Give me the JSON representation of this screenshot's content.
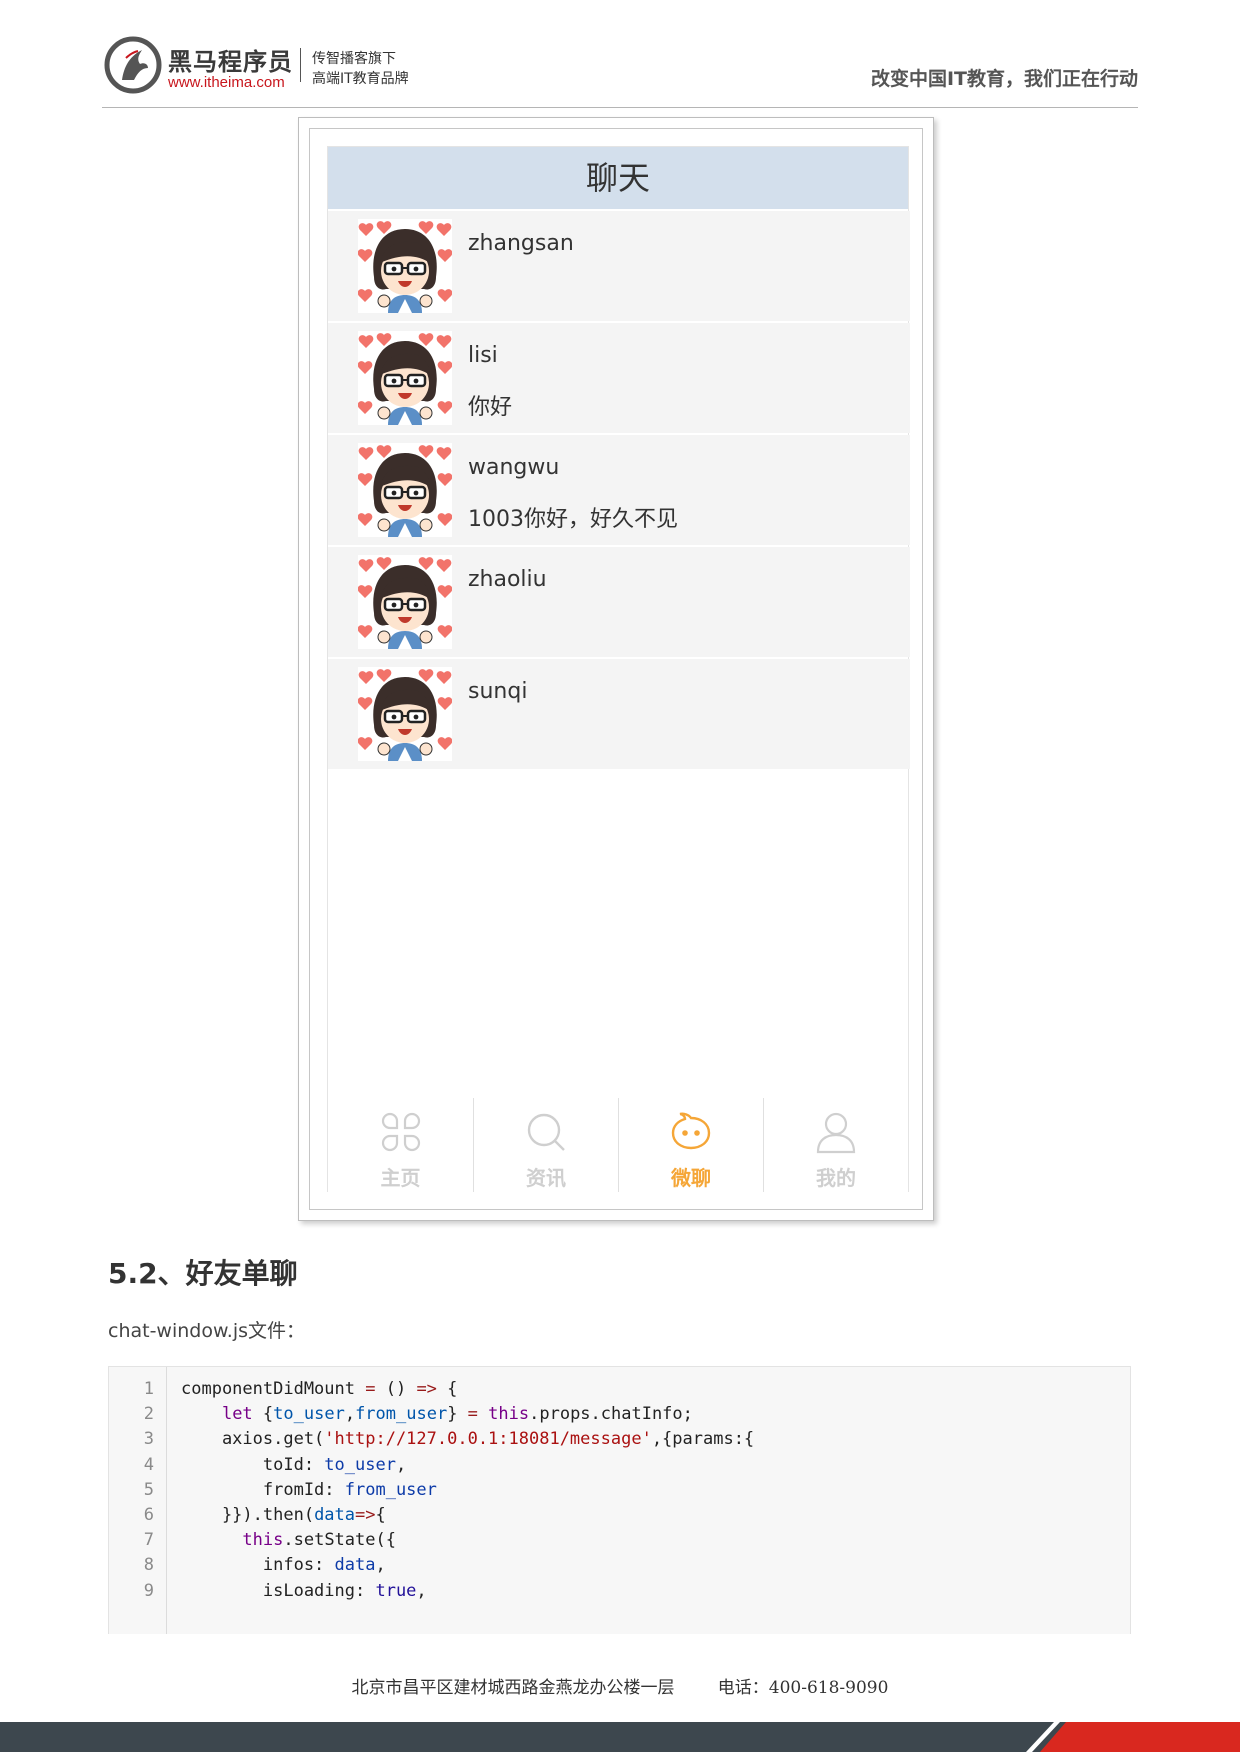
{
  "header": {
    "logo_cn": "黑马程序员",
    "logo_url": "www.itheima.com",
    "tagline_1": "传智播客旗下",
    "tagline_2": "高端IT教育品牌",
    "slogan": "改变中国IT教育，我们正在行动"
  },
  "app": {
    "title": "聊天",
    "chats": [
      {
        "name": "zhangsan",
        "message": ""
      },
      {
        "name": "lisi",
        "message": "你好"
      },
      {
        "name": "wangwu",
        "message": "1003你好，好久不见"
      },
      {
        "name": "zhaoliu",
        "message": ""
      },
      {
        "name": "sunqi",
        "message": ""
      }
    ],
    "tabs": [
      {
        "label": "主页",
        "icon": "clover-icon"
      },
      {
        "label": "资讯",
        "icon": "search-icon"
      },
      {
        "label": "微聊",
        "icon": "chat-face-icon"
      },
      {
        "label": "我的",
        "icon": "user-icon"
      }
    ],
    "active_tab": "微聊",
    "colors": {
      "title_bar": "#d3dfec",
      "active_tab": "#f5a637",
      "inactive_tab": "#cfcfcf"
    }
  },
  "section": {
    "title": "5.2、好友单聊",
    "file_label": "chat-window.js文件："
  },
  "code": {
    "line_numbers": [
      "1",
      "2",
      "3",
      "4",
      "5",
      "6",
      "7",
      "8",
      "9"
    ],
    "lines": [
      [
        [
          "t",
          "componentDidMount "
        ],
        [
          "op",
          "="
        ],
        [
          "t",
          " () "
        ],
        [
          "op",
          "=>"
        ],
        [
          "t",
          " {"
        ]
      ],
      [
        [
          "t",
          "    "
        ],
        [
          "kw",
          "let"
        ],
        [
          "t",
          " {"
        ],
        [
          "dv",
          "to_user"
        ],
        [
          "t",
          ","
        ],
        [
          "dv",
          "from_user"
        ],
        [
          "t",
          "} "
        ],
        [
          "op",
          "="
        ],
        [
          "t",
          " "
        ],
        [
          "kw",
          "this"
        ],
        [
          "t",
          ".props.chatInfo;"
        ]
      ],
      [
        [
          "t",
          "    axios.get("
        ],
        [
          "st",
          "'http://127.0.0.1:18081/message'"
        ],
        [
          "t",
          ",{params:{"
        ]
      ],
      [
        [
          "t",
          "        toId: "
        ],
        [
          "vr",
          "to_user"
        ],
        [
          "t",
          ","
        ]
      ],
      [
        [
          "t",
          "        fromId: "
        ],
        [
          "vr",
          "from_user"
        ]
      ],
      [
        [
          "t",
          "    }}).then("
        ],
        [
          "dv",
          "data"
        ],
        [
          "op",
          "=>"
        ],
        [
          "t",
          "{"
        ]
      ],
      [
        [
          "t",
          "      "
        ],
        [
          "kw",
          "this"
        ],
        [
          "t",
          ".setState({"
        ]
      ],
      [
        [
          "t",
          "        infos: "
        ],
        [
          "vr",
          "data"
        ],
        [
          "t",
          ","
        ]
      ],
      [
        [
          "t",
          "        isLoading: "
        ],
        [
          "at",
          "true"
        ],
        [
          "t",
          ","
        ]
      ]
    ]
  },
  "footer": {
    "address": "北京市昌平区建材城西路金燕龙办公楼一层",
    "phone": "电话：400-618-9090"
  }
}
